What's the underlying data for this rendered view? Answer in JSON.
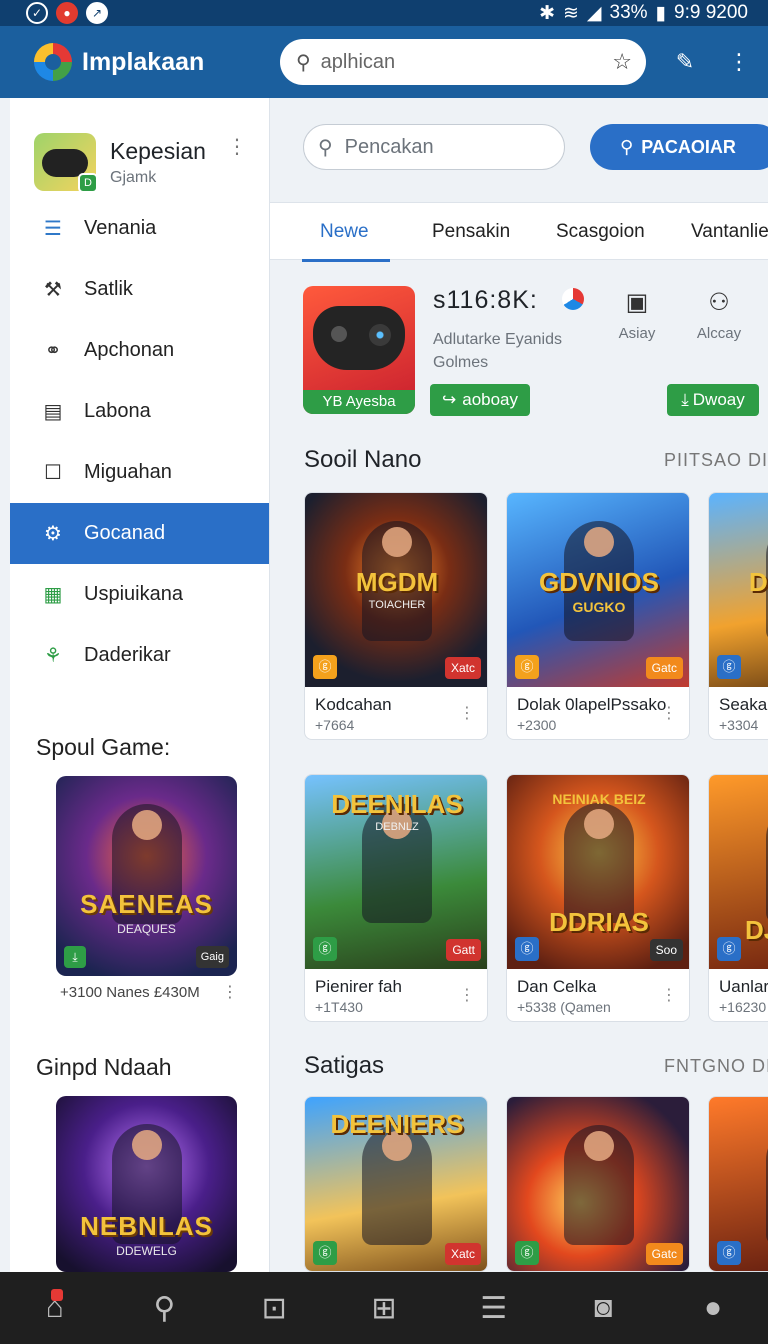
{
  "status_bar": {
    "indicator": "33%",
    "time": "9:9 9200"
  },
  "app_bar": {
    "title": "Implakaan",
    "search_placeholder": "aplhican"
  },
  "sidebar": {
    "profile": {
      "name": "Kepesian",
      "subtitle": "Gjamk"
    },
    "items": [
      {
        "label": "Venania",
        "icon": "list-icon"
      },
      {
        "label": "Satlik",
        "icon": "wrench-icon"
      },
      {
        "label": "Apchonan",
        "icon": "nodes-icon"
      },
      {
        "label": "Labona",
        "icon": "table-icon"
      },
      {
        "label": "Miguahan",
        "icon": "square-icon"
      },
      {
        "label": "Gocanad",
        "icon": "gear-icon",
        "active": true
      },
      {
        "label": "Uspiuikana",
        "icon": "grid-icon"
      },
      {
        "label": "Daderikar",
        "icon": "network-icon"
      }
    ],
    "section1": {
      "title": "Spoul Game:",
      "card_title": "SAENEAS",
      "card_subtitle": "DEAQUES",
      "card_chip": "Gaig",
      "meta": "+3100 Nanes £430M"
    },
    "section2": {
      "title": "Ginpd Ndaah",
      "card_title": "NEBNLAS",
      "card_subtitle": "DDEWELG"
    }
  },
  "main": {
    "filter_placeholder": "Pencakan",
    "primary_button": "PACAOIAR",
    "tabs": [
      "Newe",
      "Pensakin",
      "Scasgoion",
      "Vantanlie"
    ],
    "featured": {
      "price": "s116:8K:",
      "subtitle": "Adlutarke Eyanids Golmes",
      "image_tag": "YB Ayesba",
      "button1": "aoboay",
      "button2": "Dwoay",
      "actions": [
        {
          "label": "Asiay",
          "icon": "frame-icon"
        },
        {
          "label": "Alccay",
          "icon": "user-icon"
        }
      ]
    },
    "section1": {
      "title": "Sooil Nano",
      "more": "PIITSAO DI",
      "row1": [
        {
          "art_title": "MGDM",
          "art_sub": "TOIACHER",
          "chip_l": "ⓖ",
          "chip_r": "Xatc",
          "name": "Kodcahan",
          "meta": "+7664"
        },
        {
          "art_title": "GDVNIOS",
          "art_sub": "GUGKO",
          "chip_l": "ⓖ",
          "chip_r": "Gatc",
          "name": "Dolak 0lapelPssako",
          "meta": "+2300"
        },
        {
          "art_title": "DE",
          "art_sub": "",
          "chip_l": "ⓖ",
          "chip_r": "",
          "name": "Seaka",
          "meta": "+3304"
        }
      ],
      "row2": [
        {
          "art_title": "DEENILAS",
          "art_sub": "DEBNLZ",
          "chip_l": "ⓖ",
          "chip_r": "Gatt",
          "name": "Pienirer fah",
          "meta": "+1T430"
        },
        {
          "art_title": "DDRIAS",
          "art_sub": "NEINIAK BEIZ",
          "chip_l": "ⓖ",
          "chip_r": "Soo",
          "name": "Dan Celka",
          "meta": "+5338 (Qamen"
        },
        {
          "art_title": "DJ",
          "art_sub": "",
          "chip_l": "ⓖ",
          "chip_r": "",
          "name": "Uanlar",
          "meta": "+16230"
        }
      ]
    },
    "section2": {
      "title": "Satigas",
      "more": "FNTGNO DI",
      "row": [
        {
          "art_title": "DEENIERS",
          "chip_l": "ⓖ",
          "chip_r": "Xatc"
        },
        {
          "art_title": "",
          "chip_l": "ⓖ",
          "chip_r": "Gatc"
        },
        {
          "art_title": "",
          "chip_l": "ⓖ",
          "chip_r": ""
        }
      ]
    }
  },
  "bottom_nav": [
    "home-icon",
    "search-icon",
    "bag-icon",
    "plus-box-icon",
    "menu-icon",
    "camera-icon",
    "profile-icon"
  ],
  "colors": {
    "primary": "#2a6fc7",
    "app_bar": "#1b5f9e",
    "status_bar": "#0f3f6f",
    "accent_green": "#2e9d46",
    "bottom_nav": "#1f1f1f"
  }
}
